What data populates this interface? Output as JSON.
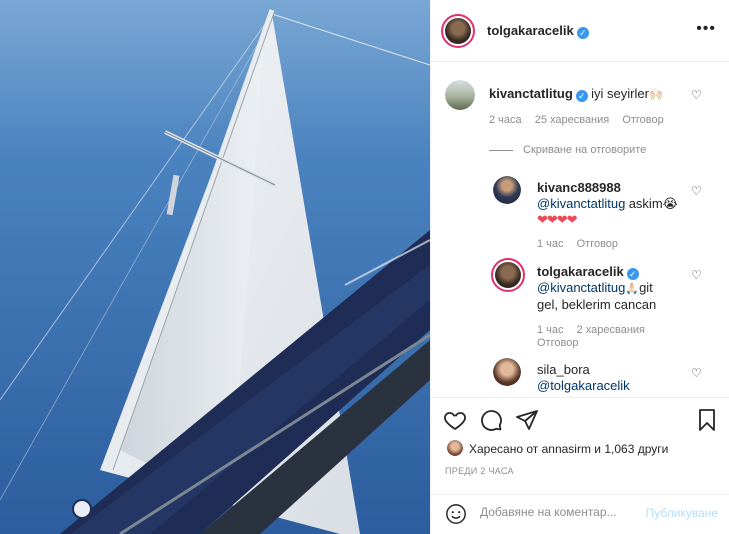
{
  "header": {
    "username": "tolgakaracelik",
    "more_icon": "more-horizontal-icon"
  },
  "comments": [
    {
      "username": "kivanctatlitug",
      "text": "iyi seyirler",
      "emoji": "🙌🏻",
      "meta": {
        "time": "2 часа",
        "likes": "25 харесвания",
        "reply": "Отговор"
      }
    },
    {
      "hide_replies": "Скриване на отговорите"
    },
    {
      "username": "kivanc888988",
      "mention": "@kivanctatlitug",
      "text": "askim😭",
      "hearts": "❤❤❤❤",
      "meta": {
        "time": "1 час",
        "reply": "Отговор"
      }
    },
    {
      "username": "tolgakaracelik",
      "mention": "@kivanctatlitug",
      "emoji": "🙏🏻",
      "text_1": "git",
      "text_2": "gel, beklerim cancan",
      "meta": {
        "time": "1 час",
        "likes": "2 харесвания",
        "reply": "Отговор"
      }
    },
    {
      "username": "sila_bora",
      "mention": "@tolgakaracelik"
    }
  ],
  "actions": {
    "liked_prefix": "Харесано от",
    "liked_user": "annasirm",
    "liked_middle": "и",
    "liked_others": "1,063 други",
    "time_ago": "ПРЕДИ 2 ЧАСА"
  },
  "add_comment": {
    "placeholder": "Добавяне на коментар...",
    "post_label": "Публикуване"
  },
  "colors": {
    "verified": "#3897f0",
    "link": "#00376b",
    "meta": "#8e8e8e",
    "post_disabled": "#b2dffc",
    "sky": "#2f63a6"
  }
}
